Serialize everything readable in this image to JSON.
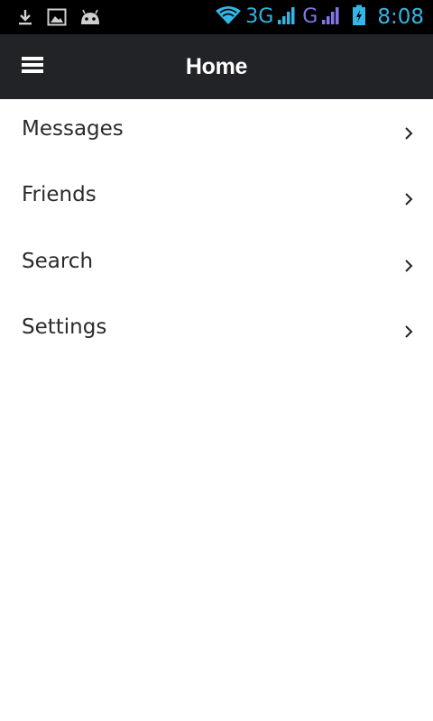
{
  "status_bar": {
    "left_icons": [
      "download-icon",
      "image-icon",
      "android-icon"
    ],
    "network_primary": "3G",
    "network_secondary": "G",
    "time": "8:08",
    "colors": {
      "accent": "#33b5e5",
      "secondary_signal": "#7f77e8"
    }
  },
  "header": {
    "title": "Home",
    "menu_icon": "hamburger-icon",
    "background": "#222326"
  },
  "menu": {
    "items": [
      {
        "label": "Messages",
        "icon": "chevron-right-icon"
      },
      {
        "label": "Friends",
        "icon": "chevron-right-icon"
      },
      {
        "label": "Search",
        "icon": "chevron-right-icon"
      },
      {
        "label": "Settings",
        "icon": "chevron-right-icon"
      }
    ]
  }
}
